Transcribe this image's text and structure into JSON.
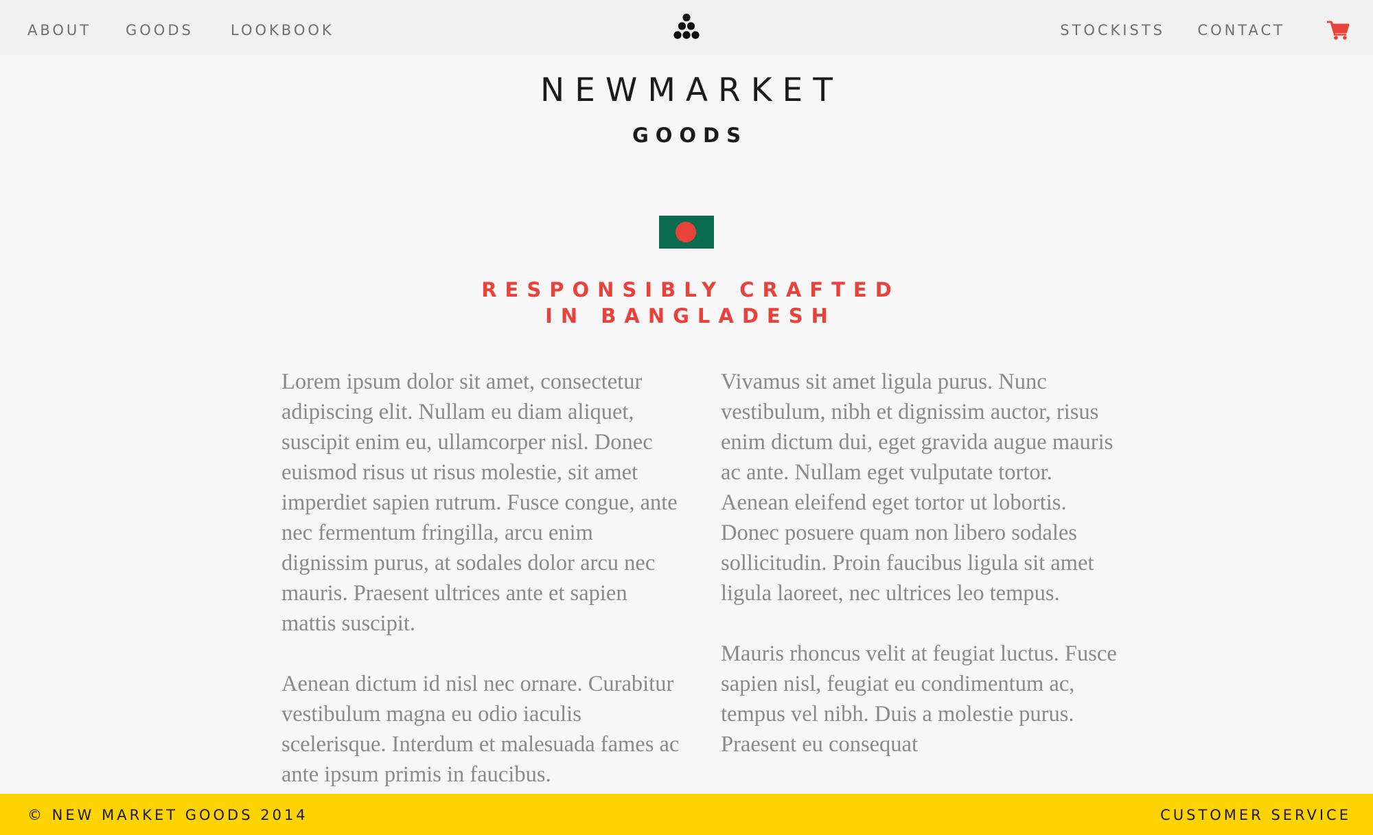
{
  "nav": {
    "left": [
      "ABOUT",
      "GOODS",
      "LOOKBOOK"
    ],
    "right": [
      "STOCKISTS",
      "CONTACT"
    ],
    "logo_icon": "triangle-dots-logo-icon",
    "cart_icon": "shopping-cart-icon"
  },
  "brand": {
    "name": "NEWMARKET",
    "sub": "GOODS"
  },
  "flag": {
    "icon": "bangladesh-flag-icon",
    "colors": {
      "field": "#0b6b4e",
      "disc": "#e8423a"
    }
  },
  "heading": {
    "line1": "RESPONSIBLY CRAFTED",
    "line2": "IN BANGLADESH"
  },
  "content": {
    "left": [
      "Lorem ipsum dolor sit amet, consectetur adipiscing elit. Nullam eu diam aliquet, suscipit enim eu, ullamcorper nisl. Donec euismod risus ut risus molestie, sit amet imperdiet sapien rutrum. Fusce congue, ante nec fermentum fringilla, arcu enim dignissim purus, at sodales dolor arcu nec mauris. Praesent ultrices ante et sapien mattis suscipit.",
      "Aenean dictum id nisl nec ornare. Curabitur vestibulum magna eu odio iaculis scelerisque. Interdum et malesuada fames ac ante ipsum primis in faucibus."
    ],
    "right": [
      "Vivamus sit amet ligula purus. Nunc vestibulum, nibh et dignissim auctor, risus enim dictum dui, eget gravida augue mauris ac ante. Nullam eget vulputate tortor. Aenean eleifend eget tortor ut lobortis. Donec posuere quam non libero sodales sollicitudin. Proin faucibus ligula sit amet ligula laoreet, nec ultrices leo tempus.",
      "Mauris rhoncus velit at feugiat luctus. Fusce sapien nisl, feugiat eu condimentum ac, tempus vel nibh. Duis a molestie purus. Praesent eu consequat"
    ]
  },
  "footer": {
    "copyright": "© NEW MARKET GOODS 2014",
    "customer_service": "CUSTOMER SERVICE"
  },
  "colors": {
    "accent": "#e8423a",
    "footer_bg": "#ffd300",
    "nav_bg": "#f1f1f1",
    "page_bg": "#f7f7f7",
    "body_text": "#8a8a8a"
  }
}
